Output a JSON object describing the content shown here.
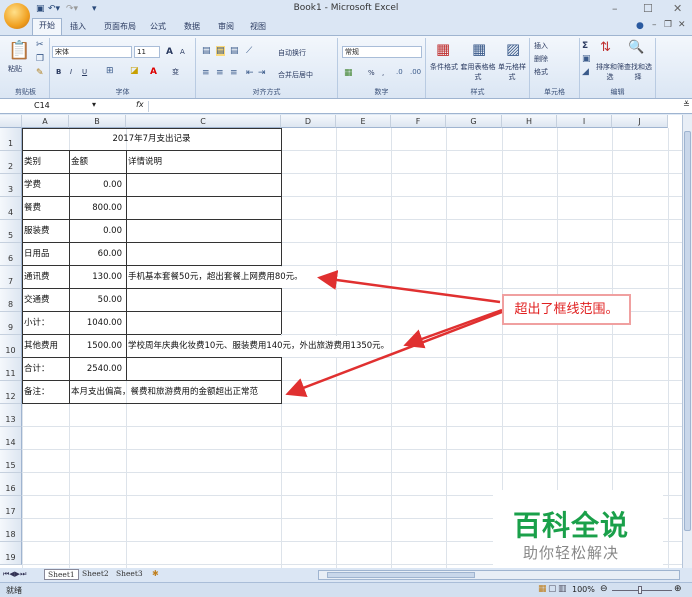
{
  "window": {
    "title": "Book1 - Microsoft Excel",
    "minimize": "–",
    "maximize": "☐",
    "close": "✕"
  },
  "tabs": [
    "开始",
    "插入",
    "页面布局",
    "公式",
    "数据",
    "审阅",
    "视图"
  ],
  "ribbon": {
    "clipboard": {
      "label": "剪贴板",
      "paste": "粘贴"
    },
    "font": {
      "label": "字体",
      "name": "宋体",
      "size": "11",
      "bold": "B",
      "italic": "I",
      "underline": "U",
      "grow": "A",
      "shrink": "A",
      "font_color": "A",
      "phonetic": "变"
    },
    "alignment": {
      "label": "对齐方式",
      "wrap": "自动换行",
      "merge": "合并后居中"
    },
    "number": {
      "label": "数字",
      "format": "常规",
      "percent": "%",
      "comma": ","
    },
    "styles": {
      "label": "样式",
      "conditional": "条件格式",
      "table": "套用表格格式",
      "cell": "单元格样式"
    },
    "cells": {
      "label": "单元格",
      "insert": "插入",
      "delete": "删除",
      "format": "格式"
    },
    "editing": {
      "label": "编辑",
      "sort": "排序和筛选",
      "find": "查找和选择",
      "sum": "Σ"
    }
  },
  "formula_bar": {
    "name_box": "C14",
    "fx": "fx",
    "value": ""
  },
  "columns": [
    "A",
    "B",
    "C",
    "D",
    "E",
    "F",
    "G",
    "H",
    "I",
    "J"
  ],
  "rows": [
    "1",
    "2",
    "3",
    "4",
    "5",
    "6",
    "7",
    "8",
    "9",
    "10",
    "11",
    "12",
    "13",
    "14",
    "15",
    "16",
    "17",
    "18",
    "19"
  ],
  "sheet": {
    "title": "2017年7月支出记录",
    "headers": [
      "类别",
      "金额",
      "详情说明"
    ],
    "data": [
      {
        "cat": "学费",
        "amt": "0.00",
        "note": ""
      },
      {
        "cat": "餐费",
        "amt": "800.00",
        "note": ""
      },
      {
        "cat": "服装费",
        "amt": "0.00",
        "note": ""
      },
      {
        "cat": "日用品",
        "amt": "60.00",
        "note": ""
      },
      {
        "cat": "通讯费",
        "amt": "130.00",
        "note": "手机基本套餐50元，超出套餐上网费用80元。"
      },
      {
        "cat": "交通费",
        "amt": "50.00",
        "note": ""
      },
      {
        "cat": "小计：",
        "amt": "1040.00",
        "note": ""
      },
      {
        "cat": "其他费用",
        "amt": "1500.00",
        "note": "学校周年庆典化妆费10元、服装费用140元，外出旅游费用1350元。"
      },
      {
        "cat": "合计：",
        "amt": "2540.00",
        "note": ""
      }
    ],
    "remark_label": "备注：",
    "remark": "本月支出偏高，餐费和旅游费用的金额超出正常范"
  },
  "annotation": "超出了框线范围。",
  "sheet_tabs": [
    "Sheet1",
    "Sheet2",
    "Sheet3"
  ],
  "status": {
    "ready": "就绪",
    "zoom": "100%"
  },
  "watermark": {
    "brand": "百科全说",
    "slogan": "助你轻松解决"
  },
  "colors": {
    "arrow": "#e03030",
    "brand": "#1aa04a"
  }
}
